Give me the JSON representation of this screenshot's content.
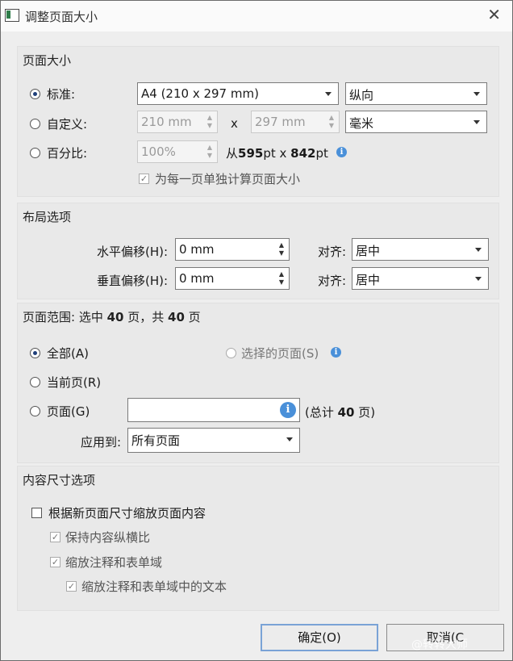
{
  "window": {
    "title": "调整页面大小",
    "close": "✕"
  },
  "page_size": {
    "heading": "页面大小",
    "standard_label": "标准:",
    "custom_label": "自定义:",
    "percent_label": "百分比:",
    "standard_value": "A4 (210 x 297 mm)",
    "orientation_value": "纵向",
    "width_value": "210 mm",
    "height_value": "297 mm",
    "times": "x",
    "unit_value": "毫米",
    "percent_value": "100%",
    "from_prefix": "从",
    "from_w": "595",
    "from_w_unit": "pt x ",
    "from_h": "842",
    "from_h_unit": "pt",
    "each_page_label": "为每一页单独计算页面大小"
  },
  "layout": {
    "heading": "布局选项",
    "h_offset_label": "水平偏移(H):",
    "h_offset_value": "0 mm",
    "v_offset_label": "垂直偏移(H):",
    "v_offset_value": "0 mm",
    "align_label": "对齐:",
    "align_h_value": "居中",
    "align_v_value": "居中"
  },
  "range": {
    "heading_prefix": "页面范围: 选中 ",
    "selected": "40",
    "heading_mid": " 页，共 ",
    "total": "40",
    "heading_suffix": " 页",
    "all_label": "全部(A)",
    "selected_pages_label": "选择的页面(S)",
    "current_label": "当前页(R)",
    "pages_label": "页面(G)",
    "pages_value": "",
    "total_prefix": "(总计 ",
    "total_count": "40",
    "total_suffix": " 页)",
    "apply_label": "应用到:",
    "apply_value": "所有页面"
  },
  "content": {
    "heading": "内容尺寸选项",
    "scale_label": "根据新页面尺寸缩放页面内容",
    "keep_ratio_label": "保持内容纵横比",
    "scale_annot_label": "缩放注释和表单域",
    "scale_annot_text_label": "缩放注释和表单域中的文本"
  },
  "buttons": {
    "ok": "确定(O)",
    "cancel": "取消(C"
  },
  "watermark": "@转转大师",
  "colors": {
    "radio_dot": "#1f3f7a",
    "info_icon": "#4a90d9",
    "primary_border": "#7aa3d6"
  },
  "icons": {
    "info": "info-icon",
    "close": "close-icon",
    "app": "app-icon"
  }
}
